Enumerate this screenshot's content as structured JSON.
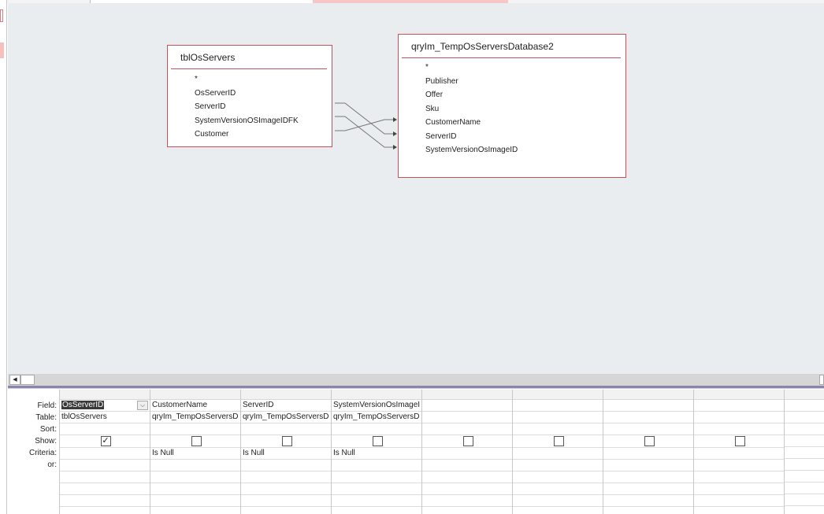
{
  "tables": [
    {
      "title": "tblOsServers",
      "fields": [
        "*",
        "OsServerID",
        "ServerID",
        "SystemVersionOSImageIDFK",
        "Customer"
      ]
    },
    {
      "title": "qryIm_TempOsServersDatabase2",
      "fields": [
        "*",
        "Publisher",
        "Offer",
        "Sku",
        "CustomerName",
        "ServerID",
        "SystemVersionOsImageID"
      ]
    }
  ],
  "row_labels": [
    "Field:",
    "Table:",
    "Sort:",
    "Show:",
    "Criteria:",
    "or:"
  ],
  "columns": [
    {
      "field": "OsServerID",
      "table": "tblOsServers",
      "sort": "",
      "show": true,
      "criteria": "",
      "or": ""
    },
    {
      "field": "CustomerName",
      "table": "qryIm_TempOsServersD",
      "sort": "",
      "show": false,
      "criteria": "Is Null",
      "or": ""
    },
    {
      "field": "ServerID",
      "table": "qryIm_TempOsServersD",
      "sort": "",
      "show": false,
      "criteria": "Is Null",
      "or": ""
    },
    {
      "field": "SystemVersionOsImageI",
      "table": "qryIm_TempOsServersD",
      "sort": "",
      "show": false,
      "criteria": "Is Null",
      "or": ""
    },
    {
      "field": "",
      "table": "",
      "sort": "",
      "show": false,
      "criteria": "",
      "or": ""
    },
    {
      "field": "",
      "table": "",
      "sort": "",
      "show": false,
      "criteria": "",
      "or": ""
    },
    {
      "field": "",
      "table": "",
      "sort": "",
      "show": false,
      "criteria": "",
      "or": ""
    },
    {
      "field": "",
      "table": "",
      "sort": "",
      "show": false,
      "criteria": "",
      "or": ""
    },
    {
      "field": "",
      "table": "",
      "sort": "",
      "show": null,
      "criteria": "",
      "or": ""
    }
  ],
  "joins": [
    {
      "from": "ServerID",
      "to": "ServerID"
    },
    {
      "from": "SystemVersionOSImageIDFK",
      "to": "SystemVersionOsImageID"
    },
    {
      "from": "Customer",
      "to": "CustomerName"
    }
  ],
  "colors": {
    "design_bg": "#e9edf0",
    "table_border": "#c4505a",
    "splitter": "#8a86a8"
  }
}
